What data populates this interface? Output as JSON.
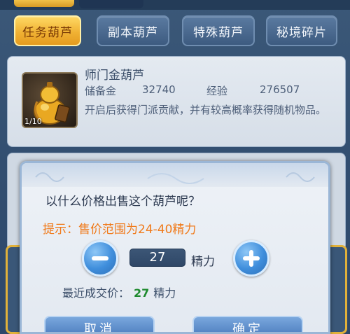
{
  "tabs": [
    {
      "label": "任务葫芦",
      "active": true
    },
    {
      "label": "副本葫芦",
      "active": false
    },
    {
      "label": "特殊葫芦",
      "active": false
    },
    {
      "label": "秘境碎片",
      "active": false
    }
  ],
  "item": {
    "name": "师门金葫芦",
    "count": "1/10",
    "reserve_label": "储备金",
    "reserve_value": "32740",
    "exp_label": "经验",
    "exp_value": "276507",
    "description": "开启后获得门派贡献，并有较高概率获得随机物品。",
    "icon": "golden-gourd-icon"
  },
  "dialog": {
    "question": "以什么价格出售这个葫芦呢？",
    "hint": "提示：售价范围为24-40精力",
    "quantity": "27",
    "unit": "精力",
    "recent_label": "最近成交价：",
    "recent_price": "27",
    "recent_unit": "精力",
    "cancel_label": "取消",
    "confirm_label": "确定"
  },
  "colors": {
    "active_tab": "#f0b234",
    "hint": "#f07a1a",
    "recent_price": "#1e8a2e",
    "button": "#3e6fb4"
  }
}
